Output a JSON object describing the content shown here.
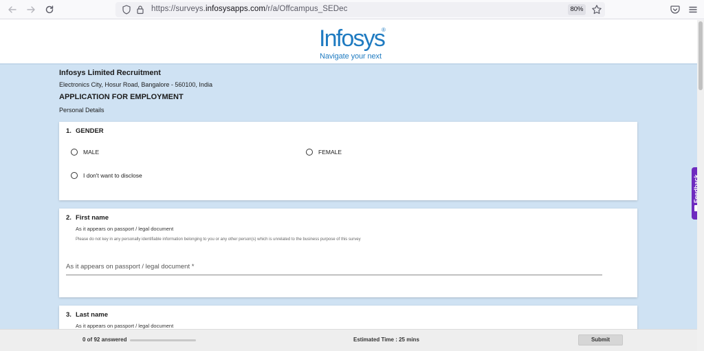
{
  "browser": {
    "url_prefix": "https://surveys.",
    "url_domain": "infosysapps.com",
    "url_path": "/r/a/Offcampus_SEDec",
    "zoom": "80%"
  },
  "brand": {
    "logo_text": "Infosys",
    "logo_reg": "®",
    "tagline": "Navigate your next"
  },
  "header": {
    "org": "Infosys Limited Recruitment",
    "address": "Electronics City, Hosur Road, Bangalore - 560100, India",
    "title": "APPLICATION FOR EMPLOYMENT",
    "section": "Personal Details"
  },
  "questions": {
    "gender": {
      "number": "1.",
      "title": "GENDER",
      "options": [
        "MALE",
        "FEMALE",
        "I don't want to disclose"
      ]
    },
    "first_name": {
      "number": "2.",
      "title": "First name",
      "subtitle": "As it appears on passport / legal document",
      "note": "Please do not key in any personally identifiable information belonging to you or any other person(s) which is unrelated to the business purpose of this survey",
      "placeholder": "As it appears on passport / legal document *",
      "value": ""
    },
    "last_name": {
      "number": "3.",
      "title": "Last name",
      "subtitle": "As it appears on passport / legal document"
    }
  },
  "feedback": {
    "label": "Feedback"
  },
  "footer": {
    "progress_text": "0 of 92 answered",
    "progress_fraction": 0,
    "estimated_time": "Estimated Time : 25 mins",
    "submit_label": "Submit"
  },
  "colors": {
    "brand_blue": "#1f7bc1",
    "page_background": "#cfe2f3",
    "feedback_purple": "#6e2bbf"
  }
}
